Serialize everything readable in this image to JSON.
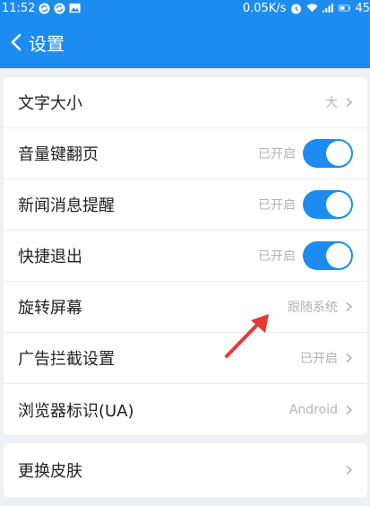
{
  "status": {
    "time": "11:52",
    "speed": "0.05K/s",
    "battery": "45"
  },
  "header": {
    "title": "设置"
  },
  "settings": [
    {
      "label": "文字大小",
      "value": "大",
      "control": "chevron"
    },
    {
      "label": "音量键翻页",
      "value": "已开启",
      "control": "toggle",
      "on": true
    },
    {
      "label": "新闻消息提醒",
      "value": "已开启",
      "control": "toggle",
      "on": true
    },
    {
      "label": "快捷退出",
      "value": "已开启",
      "control": "toggle",
      "on": true
    },
    {
      "label": "旋转屏幕",
      "value": "跟随系统",
      "control": "chevron"
    },
    {
      "label": "广告拦截设置",
      "value": "已开启",
      "control": "chevron"
    },
    {
      "label": "浏览器标识(UA)",
      "value": "Android",
      "control": "chevron"
    }
  ],
  "skin": {
    "label": "更换皮肤"
  },
  "colors": {
    "accent": "#1d8cf0",
    "annotation": "#e53935"
  }
}
